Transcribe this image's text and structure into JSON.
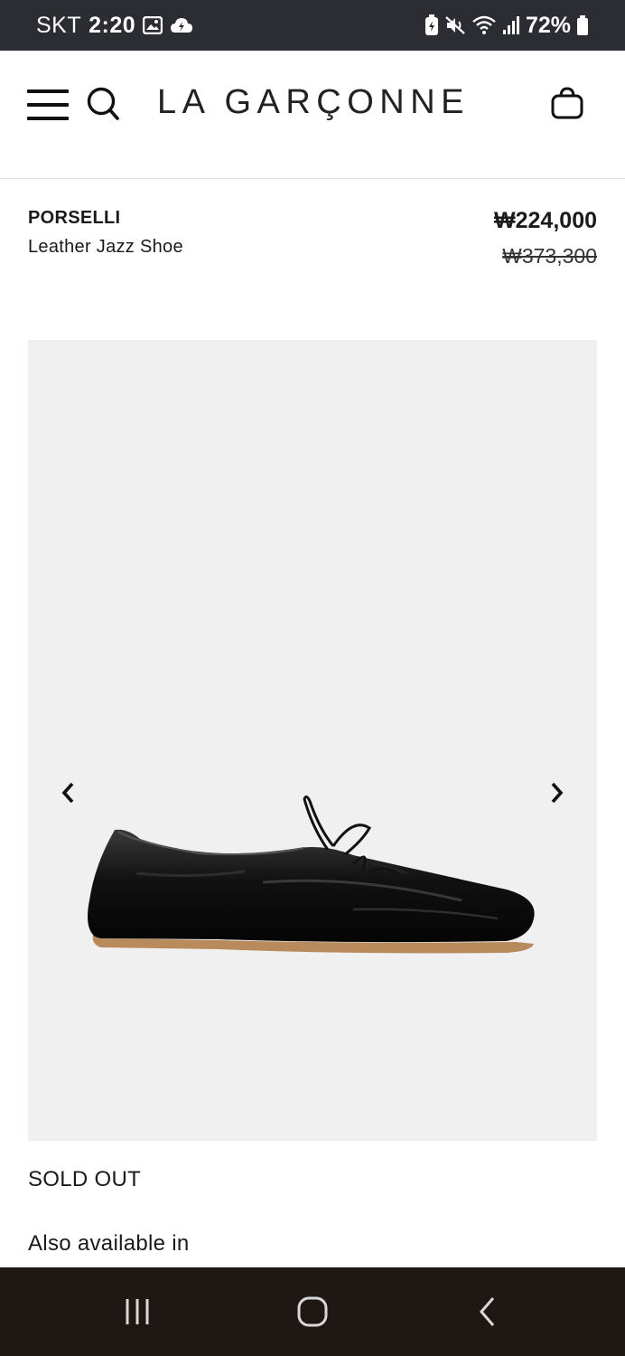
{
  "status_bar": {
    "carrier": "SKT",
    "time": "2:20",
    "battery": "72%",
    "left_icons": [
      "gallery-icon",
      "cloud-icon"
    ],
    "right_icons": [
      "battery-saver-icon",
      "mute-icon",
      "wifi-icon",
      "signal-icon",
      "battery-icon"
    ]
  },
  "header": {
    "logo": "LA GARÇONNE",
    "icons": [
      "menu-icon",
      "search-icon",
      "shopping-bag-icon"
    ]
  },
  "product": {
    "brand": "PORSELLI",
    "name": "Leather Jazz Shoe",
    "sale_price": "₩224,000",
    "original_price": "₩373,300",
    "availability": "SOLD OUT",
    "also_available_label": "Also available in"
  },
  "gallery": {
    "background": "#f0f0f0",
    "icons": [
      "chevron-left-icon",
      "chevron-right-icon"
    ]
  },
  "nav_bar": {
    "icons": [
      "recents-icon",
      "home-icon",
      "back-icon"
    ]
  },
  "colors": {
    "status_bar_bg": "#2b2d33",
    "nav_bar_bg": "#1e1714",
    "text": "#1a1a1a"
  }
}
